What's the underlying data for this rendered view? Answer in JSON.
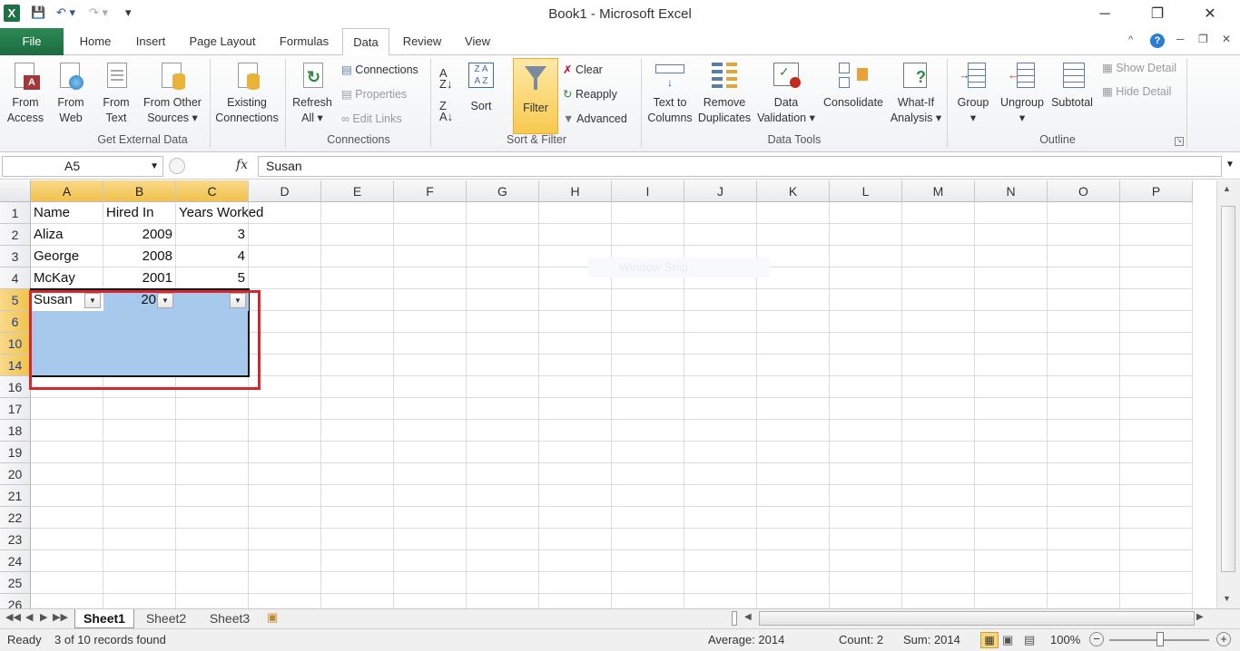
{
  "window": {
    "title": "Book1 - Microsoft Excel",
    "minimize": "─",
    "restore": "❐",
    "close": "✕"
  },
  "tabs": [
    "File",
    "Home",
    "Insert",
    "Page Layout",
    "Formulas",
    "Data",
    "Review",
    "View"
  ],
  "ribbon": {
    "get_external": {
      "from_access": [
        "From",
        "Access"
      ],
      "from_web": [
        "From",
        "Web"
      ],
      "from_text": [
        "From",
        "Text"
      ],
      "from_other": [
        "From Other",
        "Sources ▾"
      ],
      "existing": [
        "Existing",
        "Connections"
      ],
      "group_label": "Get External Data"
    },
    "connections": {
      "refresh": [
        "Refresh",
        "All ▾"
      ],
      "connections": "Connections",
      "properties": "Properties",
      "edit_links": "Edit Links",
      "group_label": "Connections"
    },
    "sort_filter": {
      "sort": "Sort",
      "filter": "Filter",
      "clear": "Clear",
      "reapply": "Reapply",
      "advanced": "Advanced",
      "group_label": "Sort & Filter"
    },
    "data_tools": {
      "text_to_columns": [
        "Text to",
        "Columns"
      ],
      "remove_duplicates": [
        "Remove",
        "Duplicates"
      ],
      "data_validation": [
        "Data",
        "Validation ▾"
      ],
      "consolidate": "Consolidate",
      "what_if": [
        "What-If",
        "Analysis ▾"
      ],
      "group_label": "Data Tools"
    },
    "outline": {
      "group": [
        "Group",
        "▾"
      ],
      "ungroup": [
        "Ungroup",
        "▾"
      ],
      "subtotal": "Subtotal",
      "show_detail": "Show Detail",
      "hide_detail": "Hide Detail",
      "group_label": "Outline"
    }
  },
  "formula_bar": {
    "name_box": "A5",
    "fx": "fx",
    "formula": "Susan"
  },
  "columns": [
    "A",
    "B",
    "C",
    "D",
    "E",
    "F",
    "G",
    "H",
    "I",
    "J",
    "K",
    "L",
    "M",
    "N",
    "O",
    "P"
  ],
  "rows": [
    "1",
    "2",
    "3",
    "4",
    "5",
    "6",
    "10",
    "14",
    "16",
    "17",
    "18",
    "19",
    "20",
    "21",
    "22",
    "23",
    "24",
    "25",
    "26"
  ],
  "cells": {
    "r1": [
      "Name",
      "Hired In",
      "Years Worked"
    ],
    "r2": [
      "Aliza",
      "2009",
      "3"
    ],
    "r3": [
      "George",
      "2008",
      "4"
    ],
    "r4": [
      "McKay",
      "2001",
      "5"
    ],
    "r5": [
      "Susan",
      "20",
      ""
    ]
  },
  "ghost_tooltip": "Window Snip",
  "sheet_tabs": [
    "Sheet1",
    "Sheet2",
    "Sheet3"
  ],
  "status": {
    "ready": "Ready",
    "records": "3 of 10 records found",
    "average": "Average: 2014",
    "count": "Count: 2",
    "sum": "Sum: 2014",
    "zoom": "100%"
  },
  "colors": {
    "file_tab": "#1e7145",
    "selection": "#a6c9ec",
    "highlight_box": "#d9262e",
    "header_sel": "#f1c24a"
  }
}
